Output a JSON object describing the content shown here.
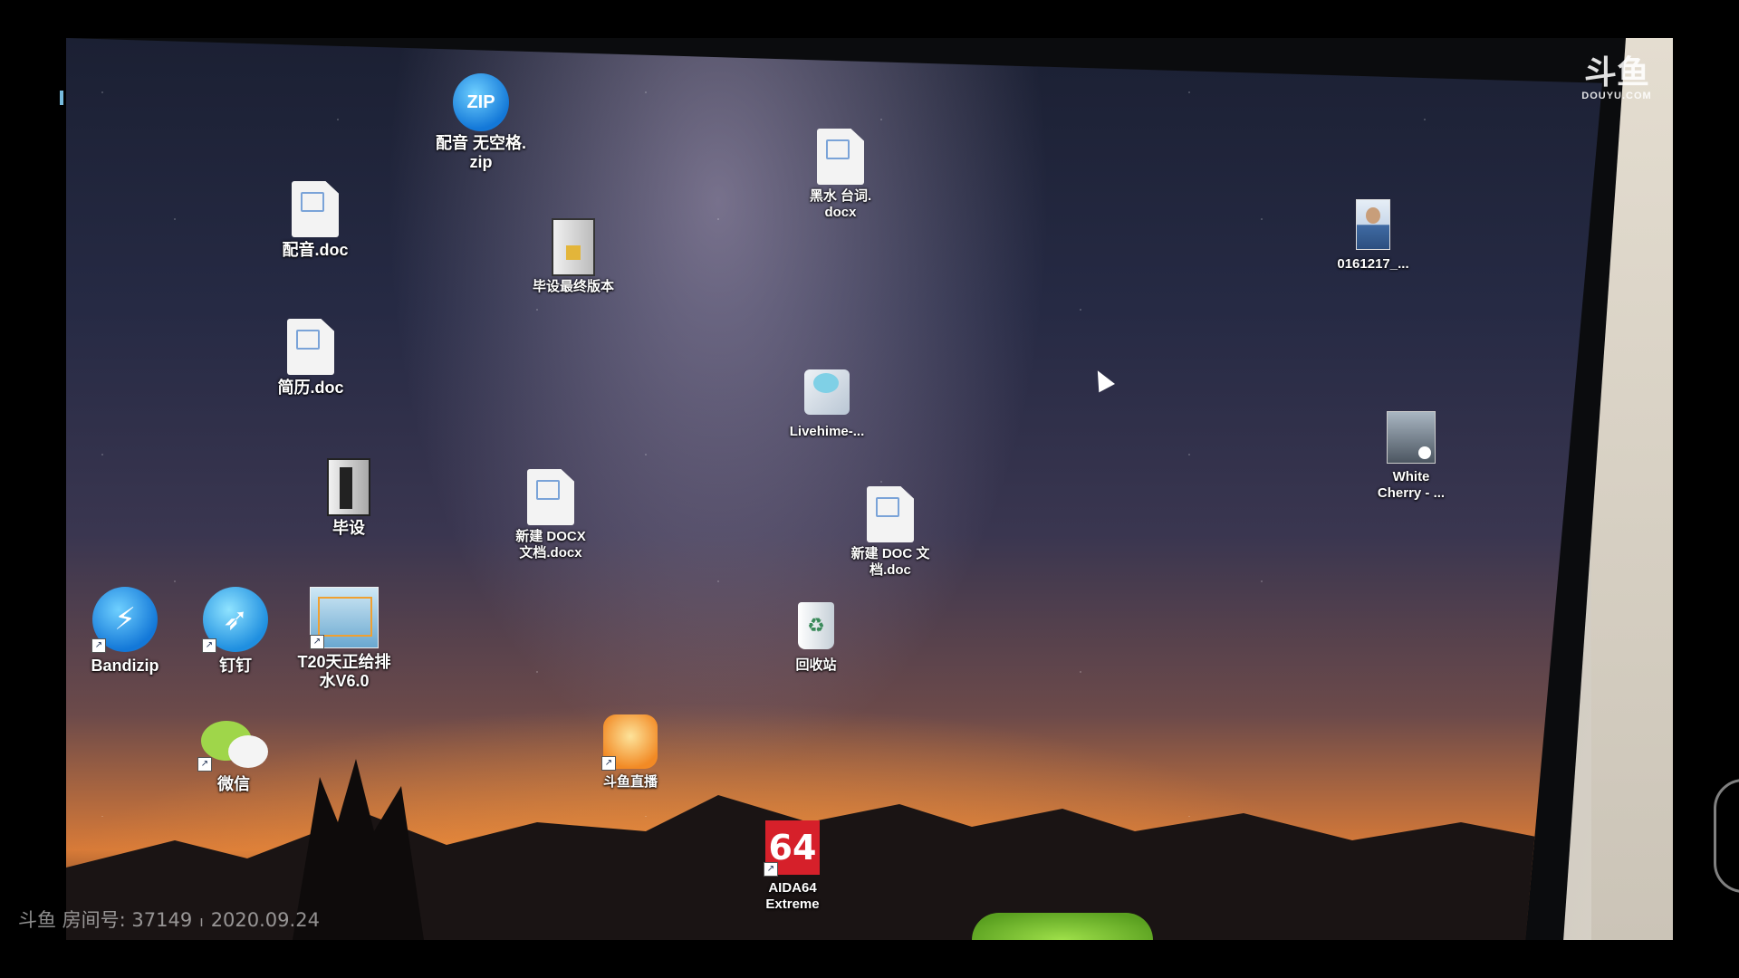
{
  "overlay": {
    "logo_main": "斗鱼",
    "logo_sub": "DOUYU.COM",
    "stream_label": "斗鱼 房间号: 37149",
    "stream_date": "2020.09.24"
  },
  "desktop_icons": {
    "zip": {
      "label": "配音 无空格.\nzip",
      "icon": "zip-archive-icon"
    },
    "peiyin_doc": {
      "label": "配音.doc",
      "icon": "word-document-icon"
    },
    "heishui_docx": {
      "label": "黑水 台词.\ndocx",
      "icon": "word-document-icon"
    },
    "bishe_final": {
      "label": "毕设最终版本",
      "icon": "rar-archive-icon"
    },
    "photo_0161217": {
      "label": "0161217_...",
      "icon": "photo-thumbnail-icon"
    },
    "jianli_doc": {
      "label": "简历.doc",
      "icon": "word-document-icon"
    },
    "livehime": {
      "label": "Livehime-...",
      "icon": "installer-icon"
    },
    "white_cherry": {
      "label": "White\nCherry - ...",
      "icon": "video-file-icon"
    },
    "bishe": {
      "label": "毕设",
      "icon": "rar-archive-icon"
    },
    "new_docx": {
      "label": "新建 DOCX\n文档.docx",
      "icon": "word-document-icon"
    },
    "new_doc": {
      "label": "新建 DOC 文\n档.doc",
      "icon": "word-document-icon"
    },
    "bandizip": {
      "label": "Bandizip",
      "icon": "bandizip-icon"
    },
    "dingding": {
      "label": "钉钉",
      "icon": "dingtalk-icon"
    },
    "t20": {
      "label": "T20天正给排\n水V6.0",
      "icon": "tangent-cad-icon"
    },
    "recycle_bin": {
      "label": "回收站",
      "icon": "recycle-bin-icon"
    },
    "wechat": {
      "label": "微信",
      "icon": "wechat-icon"
    },
    "douyu_live": {
      "label": "斗鱼直播",
      "icon": "douyu-live-icon"
    },
    "aida64": {
      "label": "AIDA64\nExtreme",
      "icon": "aida64-icon",
      "badge": "64"
    }
  }
}
